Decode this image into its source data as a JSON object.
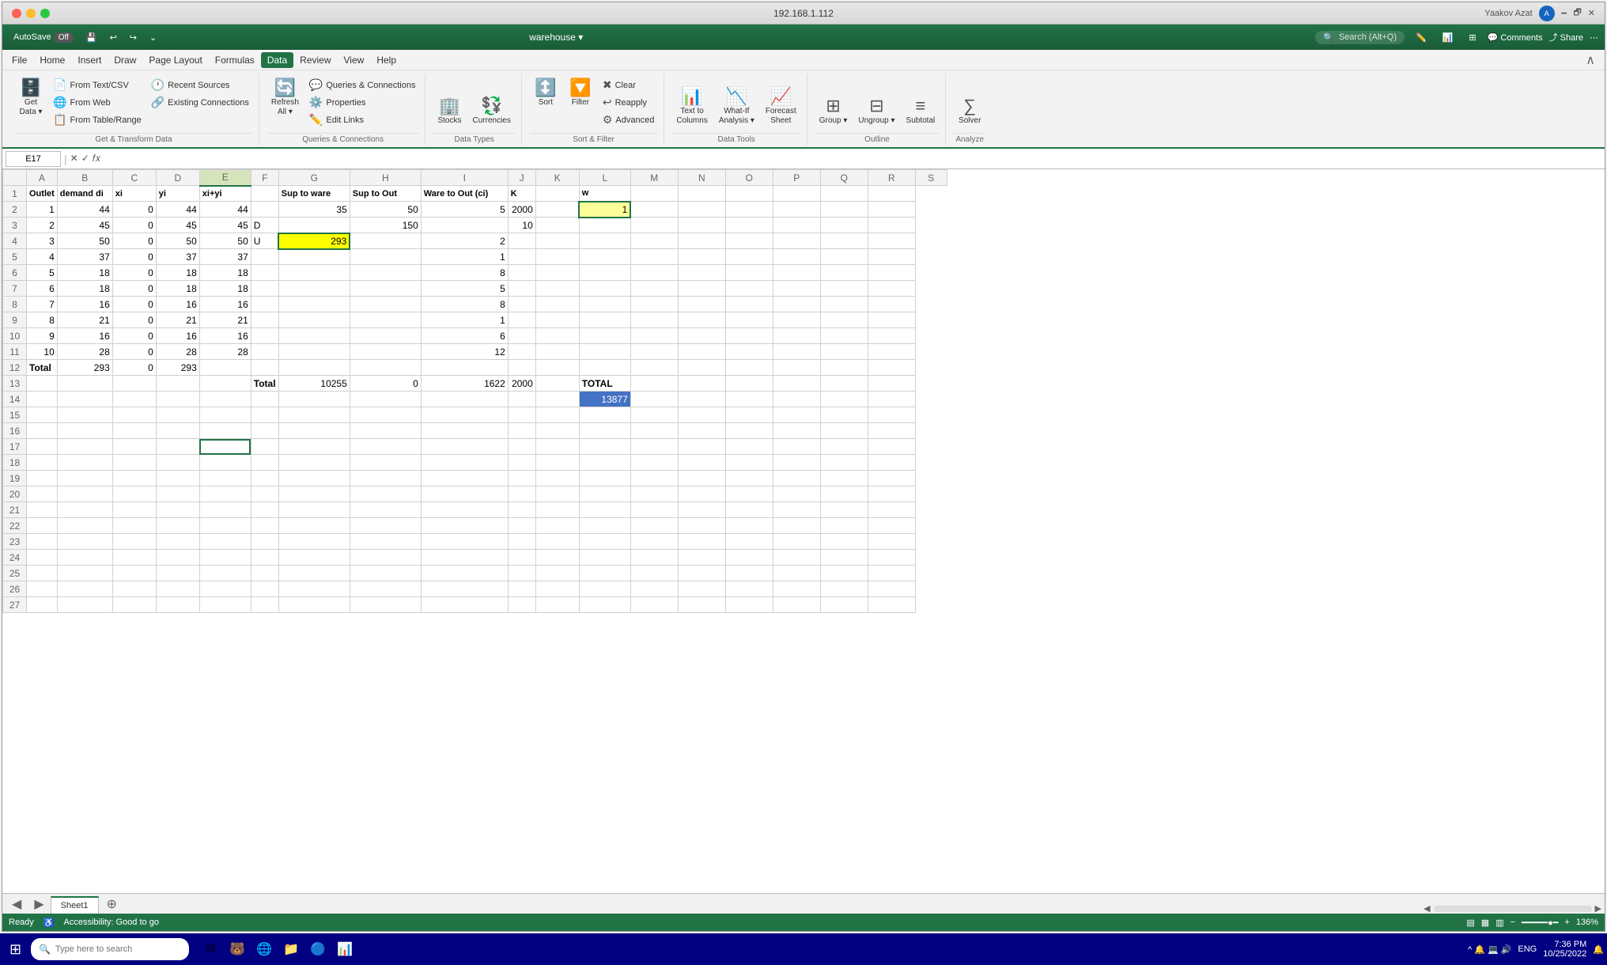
{
  "titleBar": {
    "title": "192.168.1.112",
    "userName": "Yaakov Azat",
    "userInitial": "A"
  },
  "quickAccess": {
    "autoSave": "AutoSave",
    "autoSaveState": "Off",
    "workbookName": "warehouse",
    "searchPlaceholder": "Search (Alt+Q)"
  },
  "menuItems": [
    "File",
    "Home",
    "Insert",
    "Draw",
    "Page Layout",
    "Formulas",
    "Data",
    "Review",
    "View",
    "Help"
  ],
  "activeMenu": "Data",
  "ribbon": {
    "groups": [
      {
        "label": "Get & Transform Data",
        "buttons": [
          {
            "icon": "🗄️",
            "label": "Get\nData",
            "hasDropdown": true
          },
          {
            "icon": "📄",
            "label": "From Text/CSV"
          },
          {
            "icon": "🌐",
            "label": "From Web"
          },
          {
            "icon": "📋",
            "label": "From Table/Range"
          },
          {
            "icon": "🕐",
            "label": "Recent Sources"
          },
          {
            "icon": "🔗",
            "label": "Existing Connections"
          }
        ]
      },
      {
        "label": "Queries & Connections",
        "buttons": [
          {
            "icon": "🔄",
            "label": "Refresh\nAll",
            "hasDropdown": true
          },
          {
            "icon": "💬",
            "label": "Queries &\nConnections"
          },
          {
            "icon": "⚙️",
            "label": "Properties"
          },
          {
            "icon": "✏️",
            "label": "Edit Links"
          }
        ]
      },
      {
        "label": "Data Types",
        "buttons": [
          {
            "icon": "🏢",
            "label": "Stocks"
          },
          {
            "icon": "💱",
            "label": "Currencies"
          }
        ]
      },
      {
        "label": "Sort & Filter",
        "buttons": [
          {
            "icon": "↕️",
            "label": "Sort"
          },
          {
            "icon": "🔽",
            "label": "Filter"
          },
          {
            "icon": "✖️",
            "label": "Clear"
          },
          {
            "icon": "↩️",
            "label": "Reapply"
          },
          {
            "icon": "⚙️",
            "label": "Advanced"
          }
        ]
      },
      {
        "label": "Data Tools",
        "buttons": [
          {
            "icon": "📊",
            "label": "Text to\nColumns"
          },
          {
            "icon": "📉",
            "label": "What-If\nAnalysis",
            "hasDropdown": true
          },
          {
            "icon": "📈",
            "label": "Forecast\nSheet"
          }
        ]
      },
      {
        "label": "Outline",
        "buttons": [
          {
            "icon": "⊞",
            "label": "Group",
            "hasDropdown": true
          },
          {
            "icon": "⊟",
            "label": "Ungroup",
            "hasDropdown": true
          },
          {
            "icon": "≡",
            "label": "Subtotal"
          }
        ]
      },
      {
        "label": "Analyze",
        "buttons": [
          {
            "icon": "∑",
            "label": "Solver"
          }
        ]
      }
    ]
  },
  "formulaBar": {
    "nameBox": "E17",
    "formula": ""
  },
  "columns": [
    "",
    "A",
    "B",
    "C",
    "D",
    "E",
    "F",
    "G",
    "H",
    "I",
    "J",
    "K",
    "L",
    "M",
    "N",
    "O",
    "P",
    "Q",
    "R",
    "S"
  ],
  "rows": [
    {
      "rowNum": 1,
      "cells": [
        "Outlet",
        "demand di",
        "xi",
        "yi",
        "xi+yi",
        "",
        "Sup to ware",
        "Sup to Out",
        "Ware to Out (ci)",
        "K",
        "",
        "w",
        "",
        "",
        "",
        "",
        "",
        ""
      ]
    },
    {
      "rowNum": 2,
      "cells": [
        "1",
        "44",
        "0",
        "44",
        "44",
        "",
        "35",
        "50",
        "5",
        "2000",
        "",
        "1",
        "",
        "",
        "",
        "",
        "",
        ""
      ],
      "k2Yellow": true
    },
    {
      "rowNum": 3,
      "cells": [
        "2",
        "45",
        "0",
        "45",
        "45",
        "D",
        "",
        "150",
        "",
        "10",
        "",
        "",
        "",
        "",
        "",
        "",
        "",
        ""
      ]
    },
    {
      "rowNum": 4,
      "cells": [
        "3",
        "50",
        "0",
        "50",
        "50",
        "U",
        "293",
        "",
        "2",
        "",
        "",
        "",
        "",
        "",
        "",
        "",
        "",
        ""
      ],
      "g4Yellow": true
    },
    {
      "rowNum": 5,
      "cells": [
        "4",
        "37",
        "0",
        "37",
        "37",
        "",
        "",
        "",
        "1",
        "",
        "",
        "",
        "",
        "",
        "",
        "",
        "",
        ""
      ]
    },
    {
      "rowNum": 6,
      "cells": [
        "5",
        "18",
        "0",
        "18",
        "18",
        "",
        "",
        "",
        "8",
        "",
        "",
        "",
        "",
        "",
        "",
        "",
        "",
        ""
      ]
    },
    {
      "rowNum": 7,
      "cells": [
        "6",
        "18",
        "0",
        "18",
        "18",
        "",
        "",
        "",
        "5",
        "",
        "",
        "",
        "",
        "",
        "",
        "",
        "",
        ""
      ]
    },
    {
      "rowNum": 8,
      "cells": [
        "7",
        "16",
        "0",
        "16",
        "16",
        "",
        "",
        "",
        "8",
        "",
        "",
        "",
        "",
        "",
        "",
        "",
        "",
        ""
      ]
    },
    {
      "rowNum": 9,
      "cells": [
        "8",
        "21",
        "0",
        "21",
        "21",
        "",
        "",
        "",
        "1",
        "",
        "",
        "",
        "",
        "",
        "",
        "",
        "",
        ""
      ]
    },
    {
      "rowNum": 10,
      "cells": [
        "9",
        "16",
        "0",
        "16",
        "16",
        "",
        "",
        "",
        "6",
        "",
        "",
        "",
        "",
        "",
        "",
        "",
        "",
        ""
      ]
    },
    {
      "rowNum": 11,
      "cells": [
        "10",
        "28",
        "0",
        "28",
        "28",
        "",
        "",
        "",
        "12",
        "",
        "",
        "",
        "",
        "",
        "",
        "",
        "",
        ""
      ]
    },
    {
      "rowNum": 12,
      "cells": [
        "Total",
        "293",
        "0",
        "293",
        "",
        "",
        "",
        "",
        "",
        "",
        "",
        "",
        "",
        "",
        "",
        "",
        "",
        ""
      ]
    },
    {
      "rowNum": 13,
      "cells": [
        "",
        "",
        "",
        "",
        "",
        "Total",
        "10255",
        "0",
        "1622",
        "2000",
        "",
        "TOTAL",
        "",
        "",
        "",
        "",
        "",
        ""
      ]
    },
    {
      "rowNum": 14,
      "cells": [
        "",
        "",
        "",
        "",
        "",
        "",
        "",
        "",
        "",
        "",
        "",
        "13877",
        "",
        "",
        "",
        "",
        "",
        ""
      ],
      "l14Blue": true
    },
    {
      "rowNum": 15,
      "cells": [
        "",
        "",
        "",
        "",
        "",
        "",
        "",
        "",
        "",
        "",
        "",
        "",
        "",
        "",
        "",
        "",
        "",
        ""
      ]
    },
    {
      "rowNum": 16,
      "cells": [
        "",
        "",
        "",
        "",
        "",
        "",
        "",
        "",
        "",
        "",
        "",
        "",
        "",
        "",
        "",
        "",
        "",
        ""
      ]
    },
    {
      "rowNum": 17,
      "cells": [
        "",
        "",
        "",
        "",
        "",
        "",
        "",
        "",
        "",
        "",
        "",
        "",
        "",
        "",
        "",
        "",
        "",
        ""
      ],
      "e17Selected": true
    },
    {
      "rowNum": 18,
      "cells": [
        "",
        "",
        "",
        "",
        "",
        "",
        "",
        "",
        "",
        "",
        "",
        "",
        "",
        "",
        "",
        "",
        "",
        ""
      ]
    },
    {
      "rowNum": 19,
      "cells": [
        "",
        "",
        "",
        "",
        "",
        "",
        "",
        "",
        "",
        "",
        "",
        "",
        "",
        "",
        "",
        "",
        "",
        ""
      ]
    },
    {
      "rowNum": 20,
      "cells": [
        "",
        "",
        "",
        "",
        "",
        "",
        "",
        "",
        "",
        "",
        "",
        "",
        "",
        "",
        "",
        "",
        "",
        ""
      ]
    },
    {
      "rowNum": 21,
      "cells": [
        "",
        "",
        "",
        "",
        "",
        "",
        "",
        "",
        "",
        "",
        "",
        "",
        "",
        "",
        "",
        "",
        "",
        ""
      ]
    },
    {
      "rowNum": 22,
      "cells": [
        "",
        "",
        "",
        "",
        "",
        "",
        "",
        "",
        "",
        "",
        "",
        "",
        "",
        "",
        "",
        "",
        "",
        ""
      ]
    },
    {
      "rowNum": 23,
      "cells": [
        "",
        "",
        "",
        "",
        "",
        "",
        "",
        "",
        "",
        "",
        "",
        "",
        "",
        "",
        "",
        "",
        "",
        ""
      ]
    },
    {
      "rowNum": 24,
      "cells": [
        "",
        "",
        "",
        "",
        "",
        "",
        "",
        "",
        "",
        "",
        "",
        "",
        "",
        "",
        "",
        "",
        "",
        ""
      ]
    },
    {
      "rowNum": 25,
      "cells": [
        "",
        "",
        "",
        "",
        "",
        "",
        "",
        "",
        "",
        "",
        "",
        "",
        "",
        "",
        "",
        "",
        "",
        ""
      ]
    },
    {
      "rowNum": 26,
      "cells": [
        "",
        "",
        "",
        "",
        "",
        "",
        "",
        "",
        "",
        "",
        "",
        "",
        "",
        "",
        "",
        "",
        "",
        ""
      ]
    },
    {
      "rowNum": 27,
      "cells": [
        "",
        "",
        "",
        "",
        "",
        "",
        "",
        "",
        "",
        "",
        "",
        "",
        "",
        "",
        "",
        "",
        "",
        ""
      ]
    }
  ],
  "sheetTabs": [
    "Sheet1"
  ],
  "statusBar": {
    "ready": "Ready",
    "accessibility": "Accessibility: Good to go",
    "zoomLevel": "136%"
  },
  "taskbar": {
    "searchPlaceholder": "Type here to search",
    "time": "7:36 PM",
    "date": "10/25/2022",
    "language": "ENG"
  }
}
